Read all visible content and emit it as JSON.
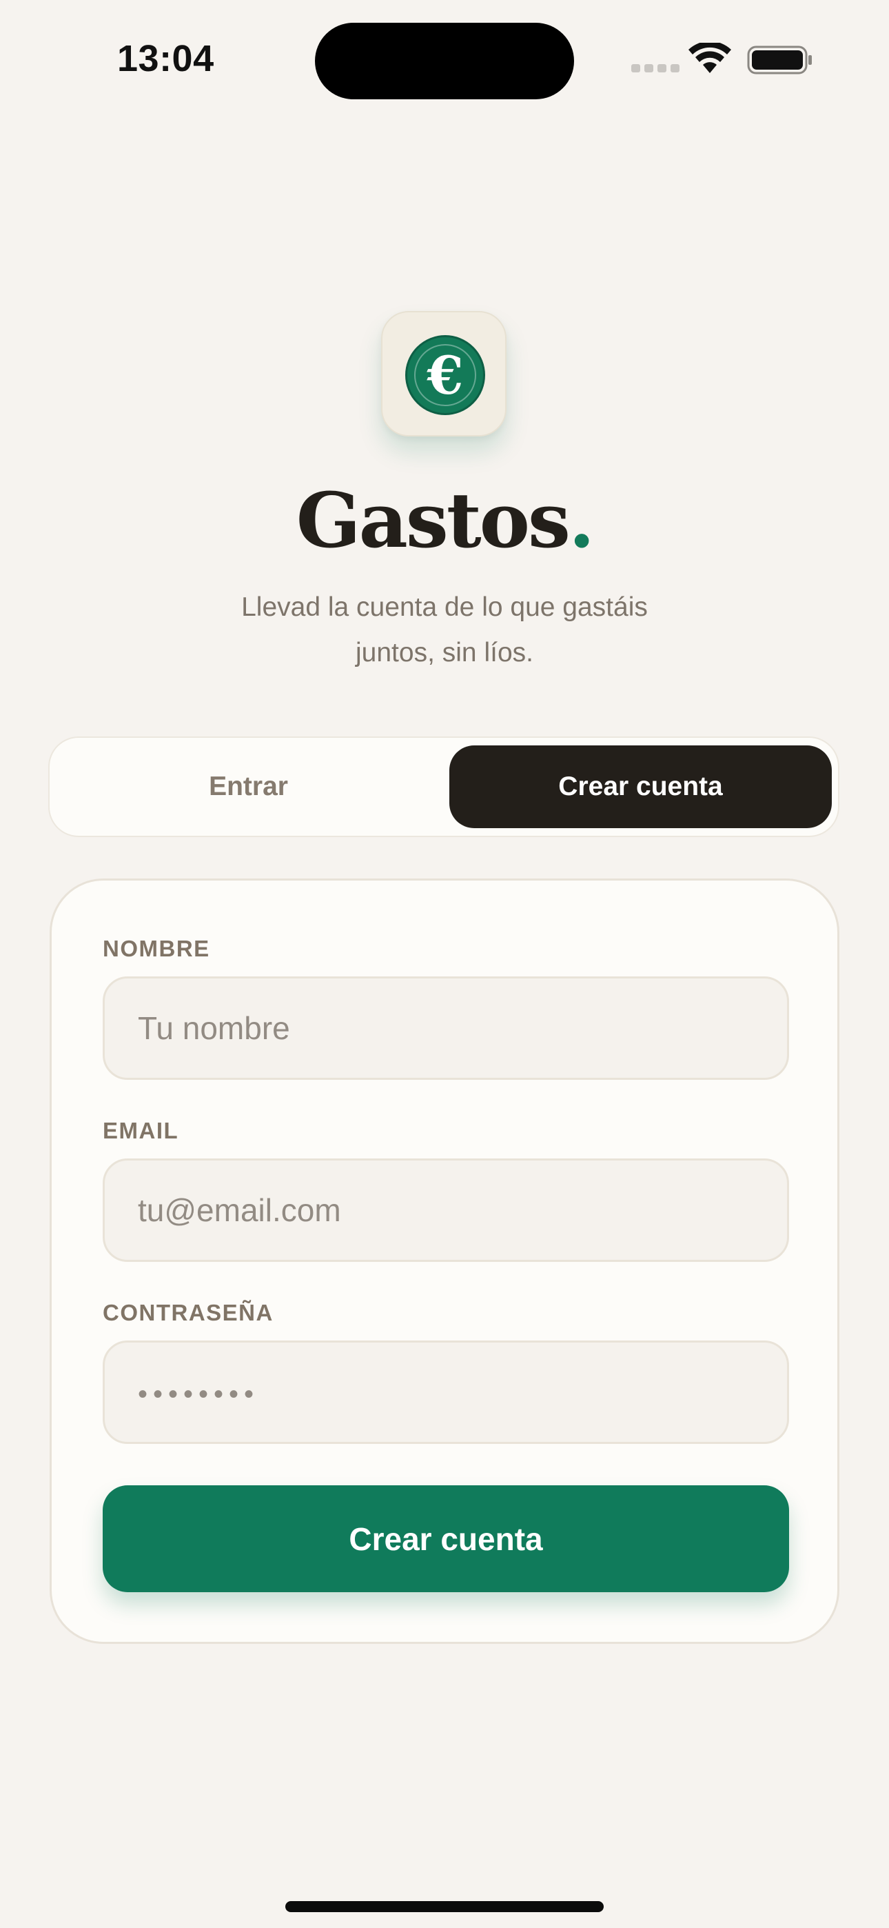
{
  "status_bar": {
    "time": "13:04"
  },
  "app": {
    "title": "Gastos",
    "title_dot": ".",
    "subtitle": "Llevad la cuenta de lo que gastáis juntos, sin líos.",
    "logo_symbol": "€",
    "logo_icon": "euro-coin-icon",
    "accent_color": "#107b5b",
    "dark_color": "#231f1a"
  },
  "tabs": {
    "login_label": "Entrar",
    "signup_label": "Crear cuenta",
    "selected": "Crear cuenta"
  },
  "form": {
    "name_label": "NOMBRE",
    "name_placeholder": "Tu nombre",
    "email_label": "EMAIL",
    "email_placeholder": "tu@email.com",
    "password_label": "CONTRASEÑA",
    "password_placeholder": "••••••••",
    "submit_label": "Crear cuenta"
  }
}
